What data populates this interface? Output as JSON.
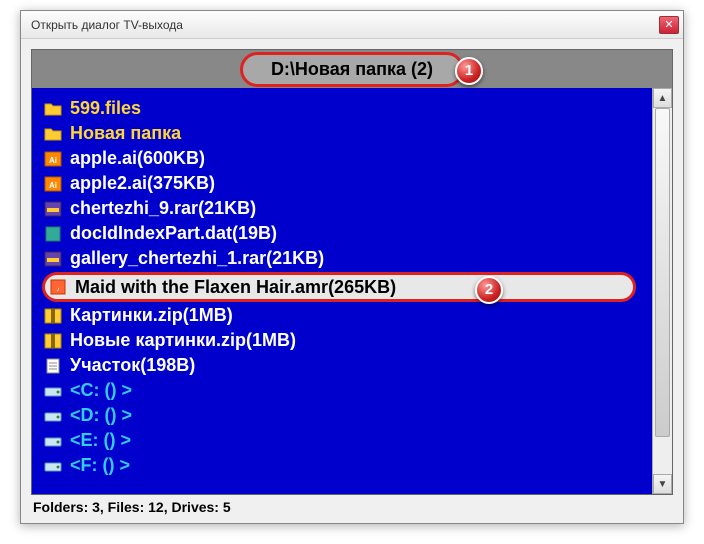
{
  "window": {
    "title": "Открыть диалог TV-выхода"
  },
  "path": "D:\\Новая папка (2)",
  "badges": {
    "one": "1",
    "two": "2"
  },
  "items": [
    {
      "type": "folder",
      "label": "599.files"
    },
    {
      "type": "folder",
      "label": "Новая папка"
    },
    {
      "type": "file",
      "icon": "ai",
      "label": "apple.ai(600KB)"
    },
    {
      "type": "file",
      "icon": "ai",
      "label": "apple2.ai(375KB)"
    },
    {
      "type": "file",
      "icon": "rar",
      "label": "chertezhi_9.rar(21KB)"
    },
    {
      "type": "file",
      "icon": "dat",
      "label": "docIdIndexPart.dat(19B)"
    },
    {
      "type": "file",
      "icon": "rar",
      "label": "gallery_chertezhi_1.rar(21KB)"
    },
    {
      "type": "file",
      "icon": "amr",
      "label": "Maid with the Flaxen Hair.amr(265KB)",
      "selected": true
    },
    {
      "type": "file",
      "icon": "zip",
      "label": "Картинки.zip(1MB)"
    },
    {
      "type": "file",
      "icon": "zip",
      "label": "Новые картинки.zip(1MB)"
    },
    {
      "type": "file",
      "icon": "txt",
      "label": "Участок(198B)"
    },
    {
      "type": "drive",
      "label": "<C: () >"
    },
    {
      "type": "drive",
      "label": "<D: () >"
    },
    {
      "type": "drive",
      "label": "<E: () >"
    },
    {
      "type": "drive",
      "label": "<F: () >"
    }
  ],
  "status": "Folders: 3, Files: 12, Drives: 5"
}
